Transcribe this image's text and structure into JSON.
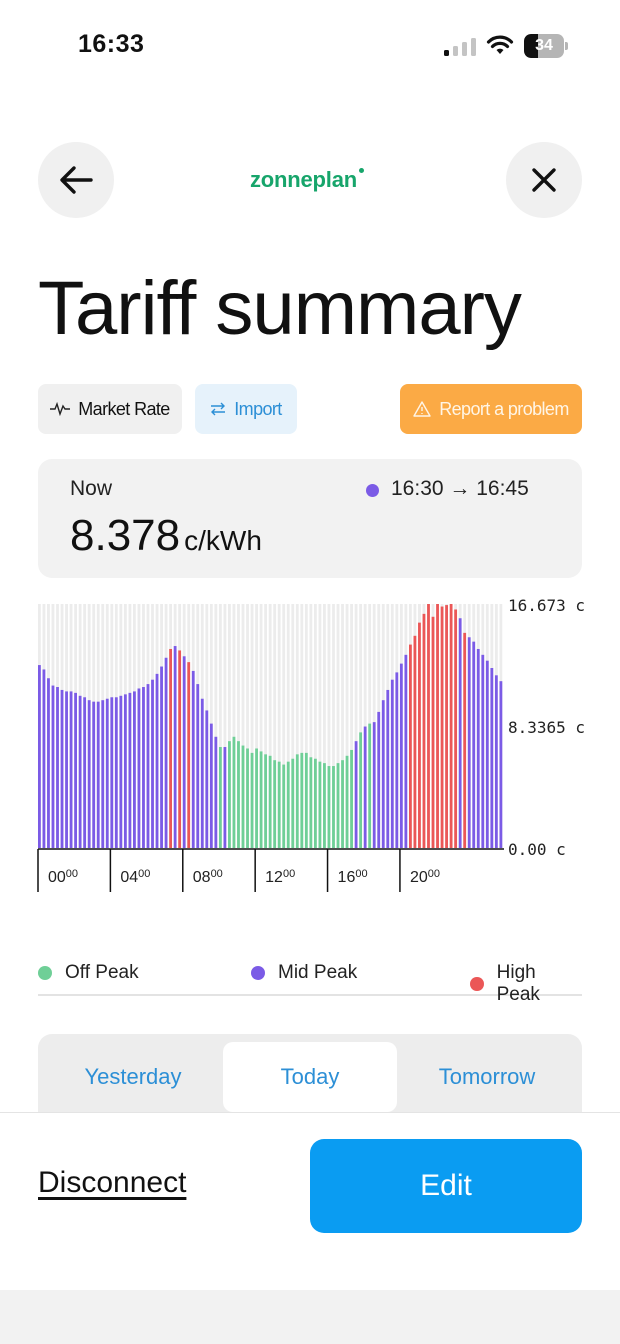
{
  "status_bar": {
    "time": "16:33",
    "battery": "34",
    "battery_level": 0.34,
    "signal_bars_active": 1
  },
  "header": {
    "logo": "zonneplan",
    "back_icon": "arrow-left-icon",
    "close_icon": "close-icon"
  },
  "title": "Tariff summary",
  "chips": {
    "market_rate": {
      "label": "Market Rate",
      "icon": "pulse-icon"
    },
    "import": {
      "label": "Import",
      "icon": "swap-arrows-icon"
    },
    "report": {
      "label": "Report a problem",
      "icon": "warning-icon"
    }
  },
  "now": {
    "label": "Now",
    "value": "8.378",
    "unit": "c/kWh",
    "range": "16:30 → 16:45",
    "dot_color": "#7b5be6"
  },
  "colors": {
    "off_peak": "#6fcf97",
    "mid_peak": "#7b5be6",
    "high_peak": "#eb5757",
    "accent": "#0a9cf2",
    "brand": "#17a56b"
  },
  "chart_data": {
    "type": "bar",
    "x_ticks": [
      "00:00",
      "04:00",
      "08:00",
      "12:00",
      "16:00",
      "20:00"
    ],
    "y_tick_labels": [
      "16.673 c",
      "8.3365 c",
      "0.00 c"
    ],
    "y_ticks": [
      16.673,
      8.3365,
      0
    ],
    "ylim": [
      0,
      16.673
    ],
    "interval_minutes": 15,
    "categories_note": "",
    "values": [
      12.5,
      12.2,
      11.6,
      11.1,
      11.0,
      10.8,
      10.7,
      10.7,
      10.6,
      10.4,
      10.3,
      10.1,
      10.0,
      10.0,
      10.1,
      10.2,
      10.3,
      10.3,
      10.4,
      10.5,
      10.6,
      10.7,
      10.9,
      11.0,
      11.2,
      11.5,
      11.9,
      12.4,
      13.0,
      13.6,
      13.8,
      13.5,
      13.1,
      12.7,
      12.1,
      11.2,
      10.2,
      9.4,
      8.5,
      7.6,
      6.9,
      6.9,
      7.3,
      7.6,
      7.3,
      7.0,
      6.8,
      6.5,
      6.8,
      6.6,
      6.4,
      6.3,
      6.0,
      5.9,
      5.7,
      5.9,
      6.1,
      6.4,
      6.5,
      6.5,
      6.2,
      6.1,
      5.9,
      5.8,
      5.6,
      5.6,
      5.8,
      6.0,
      6.3,
      6.7,
      7.3,
      7.9,
      8.3,
      8.5,
      8.6,
      9.3,
      10.1,
      10.8,
      11.5,
      12.0,
      12.6,
      13.2,
      13.9,
      14.5,
      15.4,
      16.0,
      16.673,
      15.8,
      16.673,
      16.5,
      16.6,
      16.673,
      16.3,
      15.7,
      14.7,
      14.4,
      14.1,
      13.6,
      13.2,
      12.8,
      12.3,
      11.8,
      11.4
    ],
    "peak": [
      "mid",
      "mid",
      "mid",
      "mid",
      "mid",
      "mid",
      "mid",
      "mid",
      "mid",
      "mid",
      "mid",
      "mid",
      "mid",
      "mid",
      "mid",
      "mid",
      "mid",
      "mid",
      "mid",
      "mid",
      "mid",
      "mid",
      "mid",
      "mid",
      "mid",
      "mid",
      "mid",
      "mid",
      "mid",
      "high",
      "mid",
      "high",
      "mid",
      "high",
      "mid",
      "mid",
      "mid",
      "mid",
      "mid",
      "mid",
      "off",
      "mid",
      "off",
      "off",
      "off",
      "off",
      "off",
      "off",
      "off",
      "off",
      "off",
      "off",
      "off",
      "off",
      "off",
      "off",
      "off",
      "off",
      "off",
      "off",
      "off",
      "off",
      "off",
      "off",
      "off",
      "off",
      "off",
      "off",
      "off",
      "off",
      "mid",
      "off",
      "mid",
      "off",
      "mid",
      "mid",
      "mid",
      "mid",
      "mid",
      "mid",
      "mid",
      "mid",
      "high",
      "high",
      "high",
      "high",
      "high",
      "high",
      "high",
      "high",
      "high",
      "high",
      "high",
      "mid",
      "high",
      "mid",
      "mid",
      "mid",
      "mid",
      "mid",
      "mid",
      "mid",
      "mid"
    ],
    "legend": [
      "Off Peak",
      "Mid Peak",
      "High Peak"
    ],
    "grid": true
  },
  "legend": {
    "off_peak": "Off Peak",
    "mid_peak": "Mid Peak",
    "high_peak": "High Peak"
  },
  "day_tabs": {
    "yesterday": "Yesterday",
    "today": "Today",
    "tomorrow": "Tomorrow",
    "selected": "Today"
  },
  "footer": {
    "disconnect": "Disconnect",
    "edit": "Edit"
  }
}
